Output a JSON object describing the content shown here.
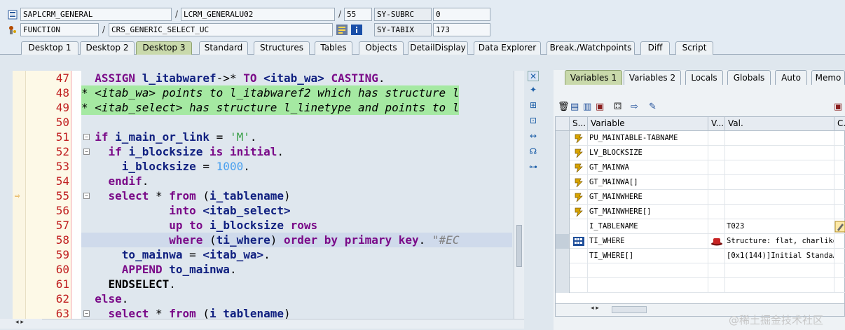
{
  "info": {
    "program": "SAPLCRM_GENERAL",
    "include": "LCRM_GENERALU02",
    "line": "55",
    "subrc_label": "SY-SUBRC",
    "subrc": "0",
    "type": "FUNCTION",
    "name": "CRS_GENERIC_SELECT_UC",
    "tabix_label": "SY-TABIX",
    "tabix": "173"
  },
  "tabs": [
    "Desktop 1",
    "Desktop 2",
    "Desktop 3",
    "Standard",
    "Structures",
    "Tables",
    "Objects",
    "DetailDisplay",
    "Data Explorer",
    "Break./Watchpoints",
    "Diff",
    "Script"
  ],
  "editor": {
    "lines": [
      {
        "num": "47",
        "text": "  ASSIGN l_itabwaref->* TO <itab_wa> CASTING."
      },
      {
        "num": "48",
        "text": "* <itab_wa> points to l_itabwaref2 which has structure l"
      },
      {
        "num": "49",
        "text": "* <itab_select> has structure l_linetype and points to l"
      },
      {
        "num": "50",
        "text": ""
      },
      {
        "num": "51",
        "text": "  if i_main_or_link = 'M'."
      },
      {
        "num": "52",
        "text": "    if i_blocksize is initial."
      },
      {
        "num": "53",
        "text": "      i_blocksize = 1000."
      },
      {
        "num": "54",
        "text": "    endif."
      },
      {
        "num": "55",
        "text": "    select * from (i_tablename)"
      },
      {
        "num": "56",
        "text": "             into <itab_select>"
      },
      {
        "num": "57",
        "text": "             up to i_blocksize rows"
      },
      {
        "num": "58",
        "text": "             where (ti_where) order by primary key. \"#EC"
      },
      {
        "num": "59",
        "text": "      to_mainwa = <itab_wa>."
      },
      {
        "num": "60",
        "text": "      APPEND to_mainwa."
      },
      {
        "num": "61",
        "text": "    ENDSELECT."
      },
      {
        "num": "62",
        "text": "  else."
      },
      {
        "num": "63",
        "text": "    select * from (i_tablename)"
      }
    ]
  },
  "vars": {
    "tabs": [
      "Variables 1",
      "Variables 2",
      "Locals",
      "Globals",
      "Auto",
      "Memo"
    ],
    "headers": {
      "s": "S...",
      "variable": "Variable",
      "v": "V...",
      "val": "Val.",
      "c": "C..."
    },
    "rows": [
      {
        "name": "PU_MAINTABLE-TABNAME",
        "value": ""
      },
      {
        "name": "LV_BLOCKSIZE",
        "value": ""
      },
      {
        "name": "GT_MAINWA",
        "value": ""
      },
      {
        "name": "GT_MAINWA[]",
        "value": ""
      },
      {
        "name": "GT_MAINWHERE",
        "value": ""
      },
      {
        "name": "GT_MAINWHERE[]",
        "value": ""
      },
      {
        "name": "I_TABLENAME",
        "value": "T023"
      },
      {
        "name": "TI_WHERE",
        "value": "Structure: flat, charlike"
      },
      {
        "name": "TI_WHERE[]",
        "value": "[0x1(144)]Initial Standa…"
      }
    ]
  },
  "watermark": "@稀土掘金技术社区"
}
